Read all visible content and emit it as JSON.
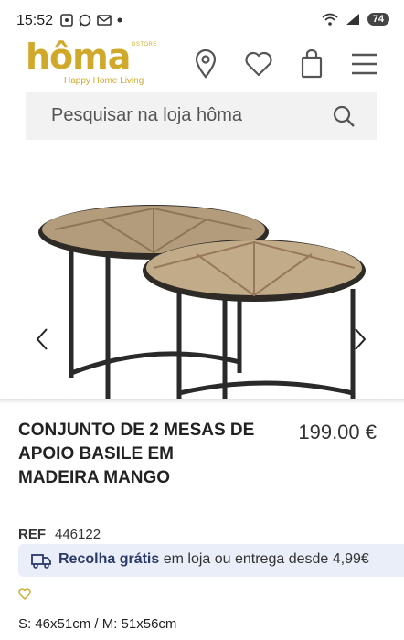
{
  "status_bar": {
    "time": "15:52",
    "battery": "74"
  },
  "brand": {
    "name": "hôma",
    "store_label": "DSTORE",
    "tagline": "Happy Home Living",
    "color": "#d1a92a"
  },
  "header": {
    "icons": [
      "location-icon",
      "heart-icon",
      "bag-icon",
      "menu-icon"
    ]
  },
  "search": {
    "placeholder": "Pesquisar na loja hôma"
  },
  "product": {
    "title": "CONJUNTO DE 2 MESAS DE APOIO BASILE EM MADEIRA MANGO",
    "price": "199.00 €",
    "ref_label": "REF",
    "ref": "446122",
    "shipping_bold": "Recolha grátis",
    "shipping_rest": "em loja ou entrega desde 4,99€",
    "size": "S: 46x51cm / M: 51x56cm"
  }
}
